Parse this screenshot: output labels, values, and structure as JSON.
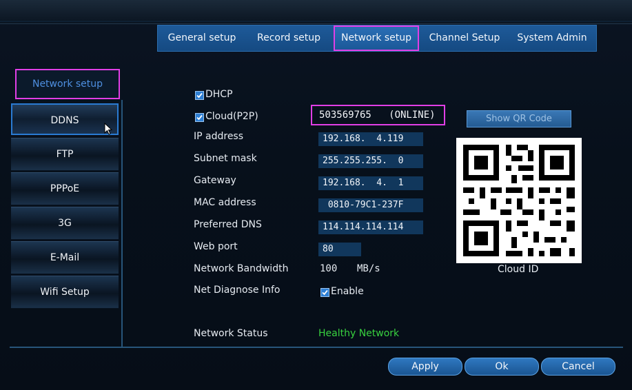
{
  "tabs": [
    {
      "label": "General setup",
      "active": false
    },
    {
      "label": "Record setup",
      "active": false
    },
    {
      "label": "Network setup",
      "active": true
    },
    {
      "label": "Channel Setup",
      "active": false
    },
    {
      "label": "System Admin",
      "active": false
    }
  ],
  "sidebar": {
    "title": "Network setup",
    "items": [
      {
        "label": "DDNS",
        "active": true
      },
      {
        "label": "FTP",
        "active": false
      },
      {
        "label": "PPPoE",
        "active": false
      },
      {
        "label": "3G",
        "active": false
      },
      {
        "label": "E-Mail",
        "active": false
      },
      {
        "label": "Wifi Setup",
        "active": false
      }
    ]
  },
  "form": {
    "dhcp": {
      "label": "DHCP",
      "checked": true
    },
    "cloud": {
      "label": "Cloud(P2P)",
      "checked": true,
      "value": "503569765   (ONLINE)"
    },
    "ip_address": {
      "label": "IP address",
      "value": "192.168.  4.119"
    },
    "subnet_mask": {
      "label": "Subnet mask",
      "value": "255.255.255.  0"
    },
    "gateway": {
      "label": "Gateway",
      "value": "192.168.  4.  1"
    },
    "mac_address": {
      "label": "MAC address",
      "value": " 0810-79C1-237F"
    },
    "preferred_dns": {
      "label": "Preferred DNS",
      "value": "114.114.114.114"
    },
    "web_port": {
      "label": "Web port",
      "value": "80"
    },
    "bandwidth": {
      "label": "Network Bandwidth",
      "value": "100",
      "unit": "MB/s"
    },
    "diagnose": {
      "label": "Net Diagnose Info",
      "enable_label": "Enable",
      "checked": true
    },
    "network_status": {
      "label": "Network Status",
      "value": "Healthy Network"
    }
  },
  "qr": {
    "button_label": "Show QR Code",
    "caption": "Cloud ID"
  },
  "buttons": {
    "apply": "Apply",
    "ok": "Ok",
    "cancel": "Cancel"
  },
  "colors": {
    "accent_highlight": "#e23ee6",
    "status_ok": "#38d23f",
    "tab_blue": "#1e5a99"
  }
}
